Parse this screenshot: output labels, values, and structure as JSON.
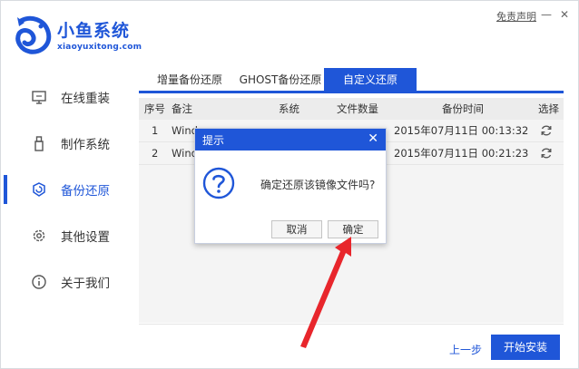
{
  "header": {
    "brand_name": "小鱼系统",
    "brand_sub": "xiaoyuxitong.com",
    "disclaimer": "免责声明",
    "minimize_glyph": "—",
    "close_glyph": "✕"
  },
  "sidebar": {
    "items": [
      {
        "label": "在线重装",
        "icon": "monitor-icon"
      },
      {
        "label": "制作系统",
        "icon": "usb-icon"
      },
      {
        "label": "备份还原",
        "icon": "backup-icon",
        "active": true
      },
      {
        "label": "其他设置",
        "icon": "gear-icon"
      },
      {
        "label": "关于我们",
        "icon": "info-icon"
      }
    ]
  },
  "main": {
    "tabs": [
      {
        "label": "增量备份还原"
      },
      {
        "label": "GHOST备份还原"
      },
      {
        "label": "自定义还原",
        "active": true
      }
    ],
    "table": {
      "headers": [
        "序号",
        "备注",
        "系统",
        "文件数量",
        "备份时间",
        "选择"
      ],
      "rows": [
        {
          "index": "1",
          "note": "Wind",
          "time": "2015年07月11日 00:13:32"
        },
        {
          "index": "2",
          "note": "Wind",
          "time": "2015年07月11日 00:21:23"
        }
      ]
    }
  },
  "footer": {
    "prev_label": "上一步",
    "start_label": "开始安装"
  },
  "dialog": {
    "title": "提示",
    "close_glyph": "✕",
    "message": "确定还原该镜像文件吗?",
    "cancel_label": "取消",
    "confirm_label": "确定"
  },
  "colors": {
    "accent": "#1f56d8",
    "annotation_arrow": "#e8262c"
  }
}
